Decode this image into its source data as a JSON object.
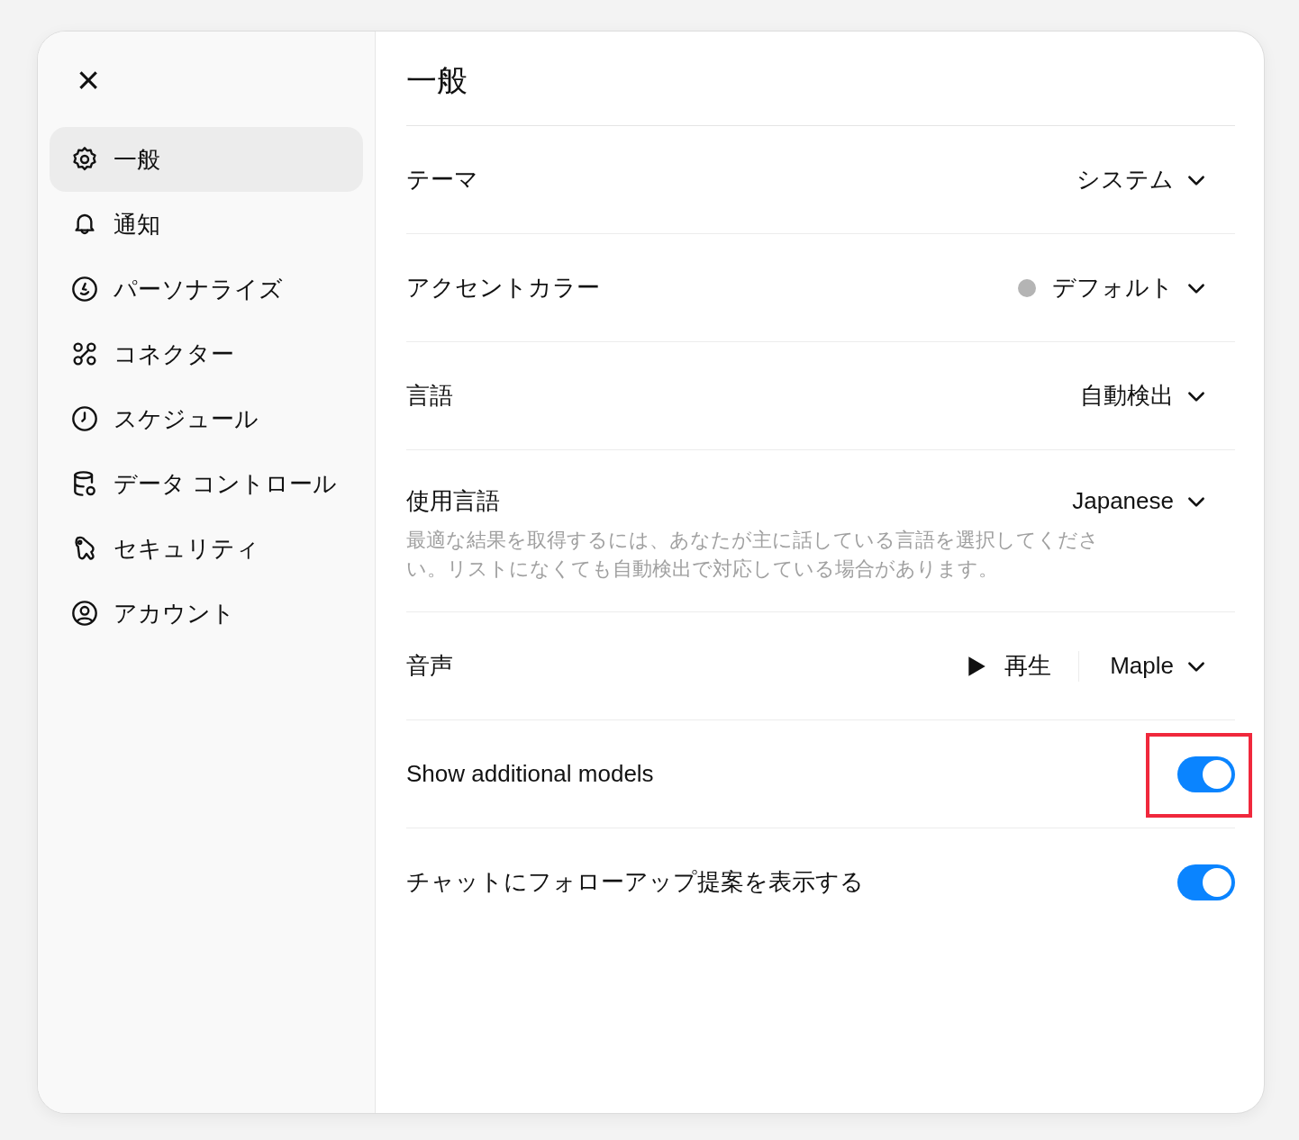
{
  "close_button": {
    "label": "×"
  },
  "sidebar": {
    "items": [
      {
        "label": "一般",
        "selected": true
      },
      {
        "label": "通知",
        "selected": false
      },
      {
        "label": "パーソナライズ",
        "selected": false
      },
      {
        "label": "コネクター",
        "selected": false
      },
      {
        "label": "スケジュール",
        "selected": false
      },
      {
        "label": "データ コントロール",
        "selected": false
      },
      {
        "label": "セキュリティ",
        "selected": false
      },
      {
        "label": "アカウント",
        "selected": false
      }
    ]
  },
  "page_title": "一般",
  "settings": [
    {
      "kind": "select",
      "label": "テーマ",
      "value": "システム"
    },
    {
      "kind": "select",
      "label": "アクセントカラー",
      "value": "デフォルト",
      "color": "#b4b4b4"
    },
    {
      "kind": "select",
      "label": "言語",
      "value": "自動検出"
    },
    {
      "kind": "select",
      "label": "使用言語",
      "value": "Japanese",
      "description": "最適な結果を取得するには、あなたが主に話している言語を選択してください。リストになくても自動検出で対応している場合があります。"
    },
    {
      "kind": "voice",
      "label": "音声",
      "play_label": "再生",
      "value": "Maple"
    },
    {
      "kind": "toggle",
      "label": "Show additional models",
      "on": true,
      "highlighted": true
    },
    {
      "kind": "toggle",
      "label": "チャットにフォローアップ提案を表示する",
      "on": true
    }
  ]
}
